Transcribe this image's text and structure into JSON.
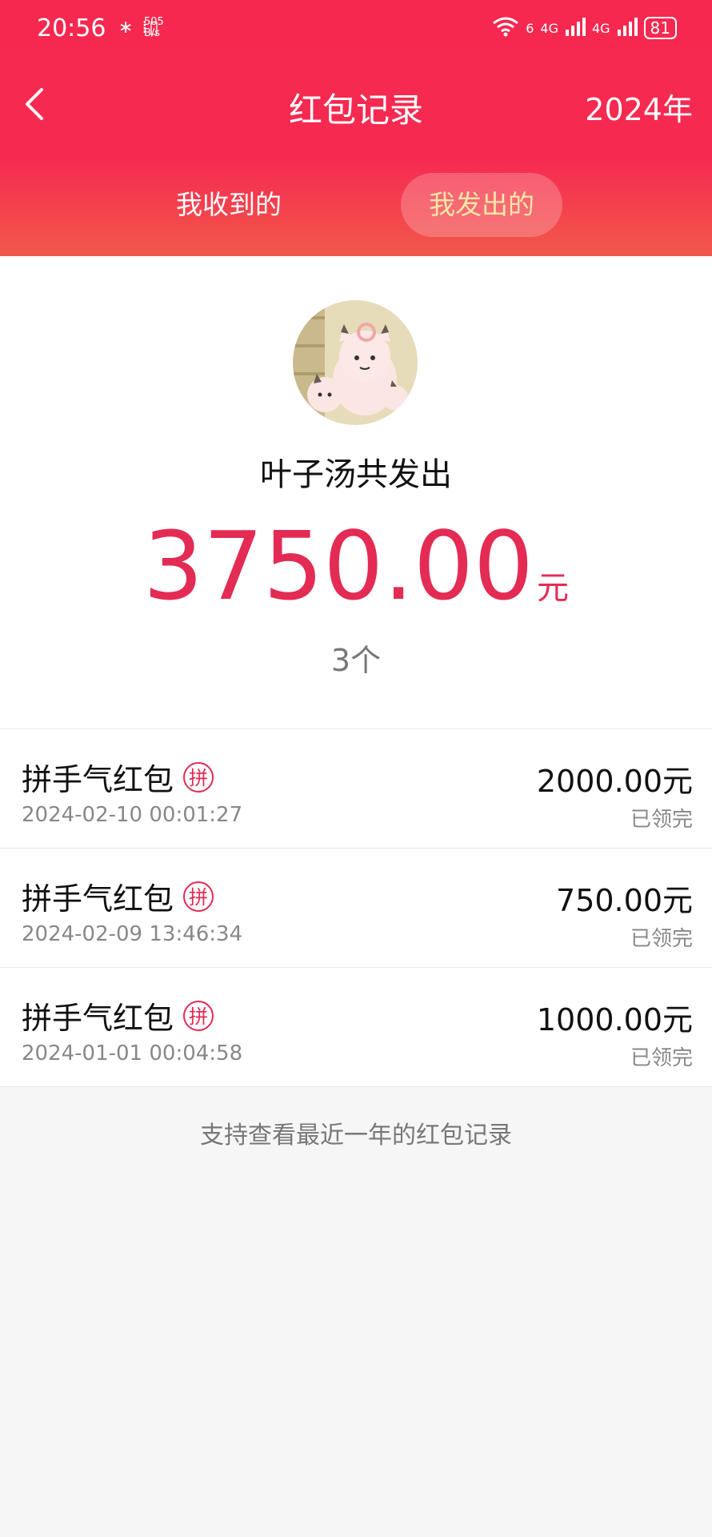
{
  "status_bar": {
    "time": "20:56",
    "icons": "∗ ⁞▯",
    "net_rate_top": "505",
    "net_rate_bottom": "B/s",
    "wifi": "6",
    "signal1": "4G",
    "signal2": "4G",
    "battery": "81"
  },
  "navbar": {
    "title": "红包记录",
    "year": "2024年"
  },
  "tabs": {
    "received": "我收到的",
    "sent": "我发出的",
    "active": "sent"
  },
  "summary": {
    "sender_text": "叶子汤共发出",
    "amount": "3750.00",
    "unit": "元",
    "count": "3个"
  },
  "records": [
    {
      "name": "拼手气红包",
      "badge": "拼",
      "date": "2024-02-10 00:01:27",
      "amount": "2000.00元",
      "status": "已领完"
    },
    {
      "name": "拼手气红包",
      "badge": "拼",
      "date": "2024-02-09 13:46:34",
      "amount": "750.00元",
      "status": "已领完"
    },
    {
      "name": "拼手气红包",
      "badge": "拼",
      "date": "2024-01-01 00:04:58",
      "amount": "1000.00元",
      "status": "已领完"
    }
  ],
  "footer_note": "支持查看最近一年的红包记录",
  "colors": {
    "accent": "#e32b54",
    "header": "#f62a51",
    "active_tab": "#ffe6a7"
  }
}
